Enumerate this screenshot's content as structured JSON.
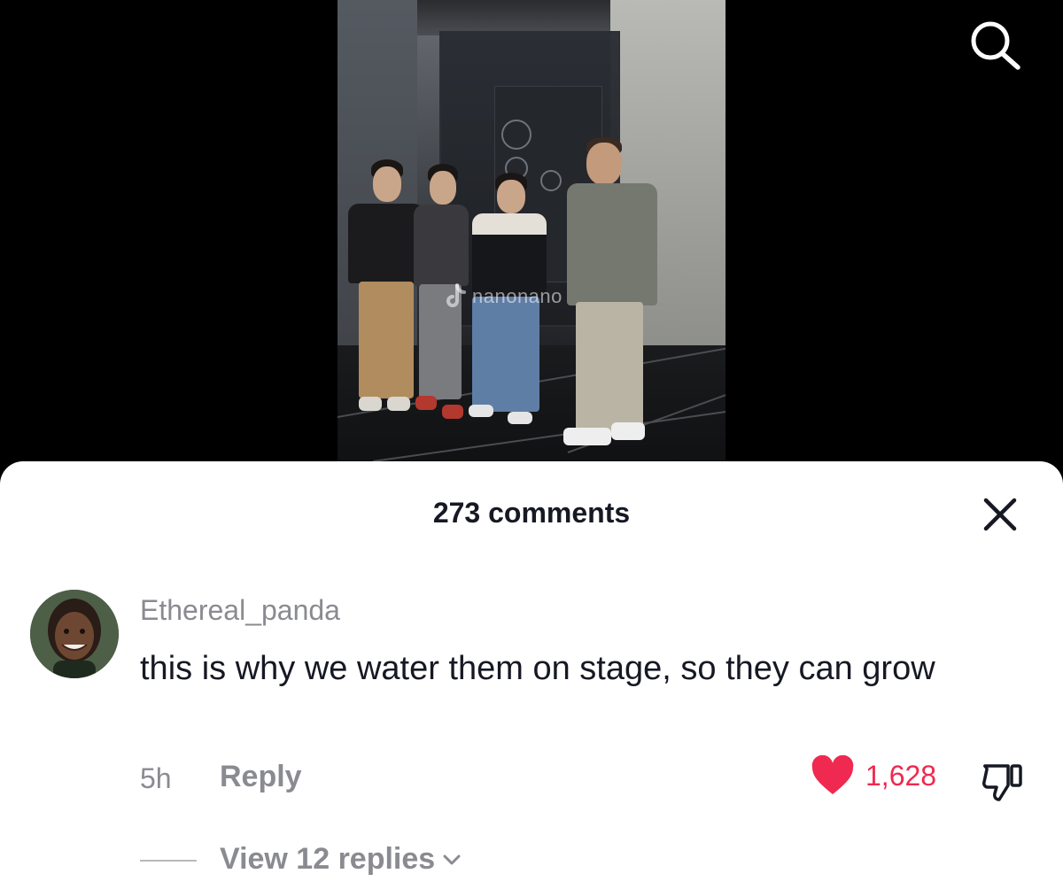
{
  "video": {
    "watermark_text": "nanonano",
    "icons": {
      "search": "search-icon",
      "tiktok_logo": "tiktok-logo-icon"
    }
  },
  "comments_sheet": {
    "title": "273 comments",
    "close_icon": "close-icon",
    "comment": {
      "username": "Ethereal_panda",
      "text": "this is why we water them on stage, so they can grow",
      "time": "5h",
      "reply_label": "Reply",
      "like_count": "1,628",
      "liked": true,
      "view_replies_label": "View 12 replies",
      "icons": {
        "like": "heart-icon",
        "dislike": "thumbs-down-icon",
        "expand": "chevron-down-icon"
      }
    }
  },
  "colors": {
    "like_accent": "#ef2950",
    "muted_text": "#8a8b91",
    "primary_text": "#161823",
    "sheet_background": "#ffffff",
    "video_background": "#000000"
  }
}
